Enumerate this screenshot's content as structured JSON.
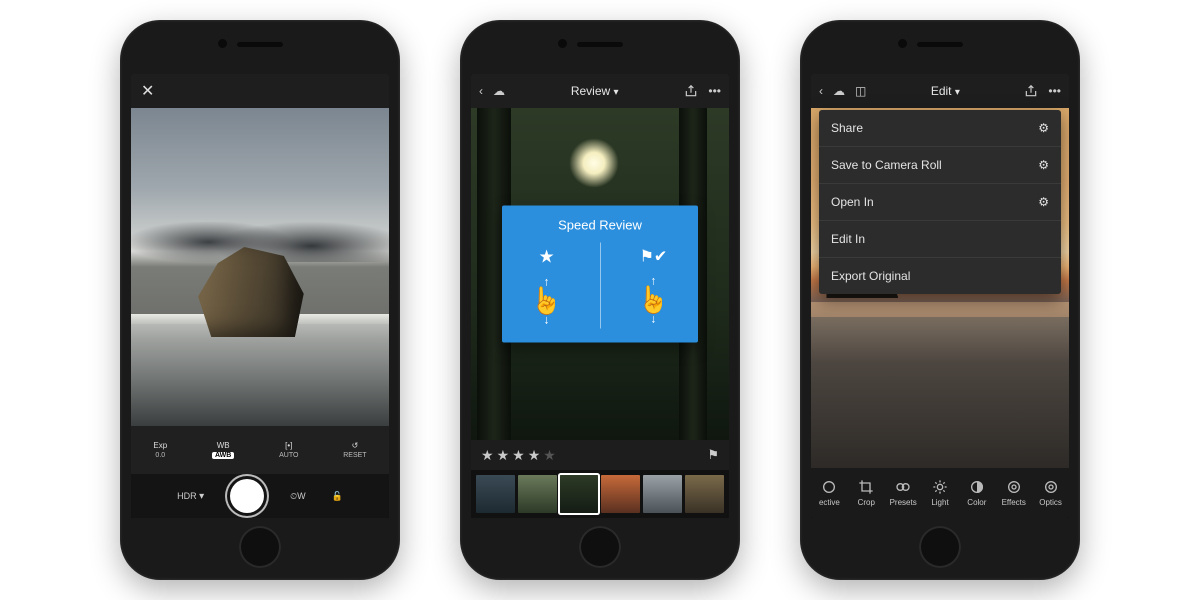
{
  "phone1": {
    "camera_controls": {
      "exposure": {
        "label": "Exp",
        "value": "0.0"
      },
      "white_balance": {
        "label": "WB",
        "chip": "AWB"
      },
      "focus": {
        "label": "AUTO",
        "icon": "[•]"
      },
      "reset": {
        "label": "RESET"
      }
    },
    "shutter_bar": {
      "mode": "HDR",
      "mode_chevron": "▾",
      "timer_icon": "⏲",
      "timer_suffix": "W",
      "lock_icon": "🔓"
    }
  },
  "phone2": {
    "topbar": {
      "title": "Review",
      "chevron": "▾"
    },
    "overlay": {
      "title": "Speed Review"
    },
    "rating": {
      "stars": 4,
      "max": 5
    },
    "thumbnails": 6
  },
  "phone3": {
    "topbar": {
      "title": "Edit",
      "chevron": "▾"
    },
    "share_menu": {
      "items": [
        {
          "label": "Share",
          "gear": true
        },
        {
          "label": "Save to Camera Roll",
          "gear": true
        },
        {
          "label": "Open In",
          "gear": true
        },
        {
          "label": "Edit In",
          "gear": false
        },
        {
          "label": "Export Original",
          "gear": false
        }
      ]
    },
    "edit_tools": [
      {
        "label": "ective"
      },
      {
        "label": "Crop"
      },
      {
        "label": "Presets"
      },
      {
        "label": "Light"
      },
      {
        "label": "Color"
      },
      {
        "label": "Effects"
      },
      {
        "label": "Optics"
      }
    ]
  }
}
